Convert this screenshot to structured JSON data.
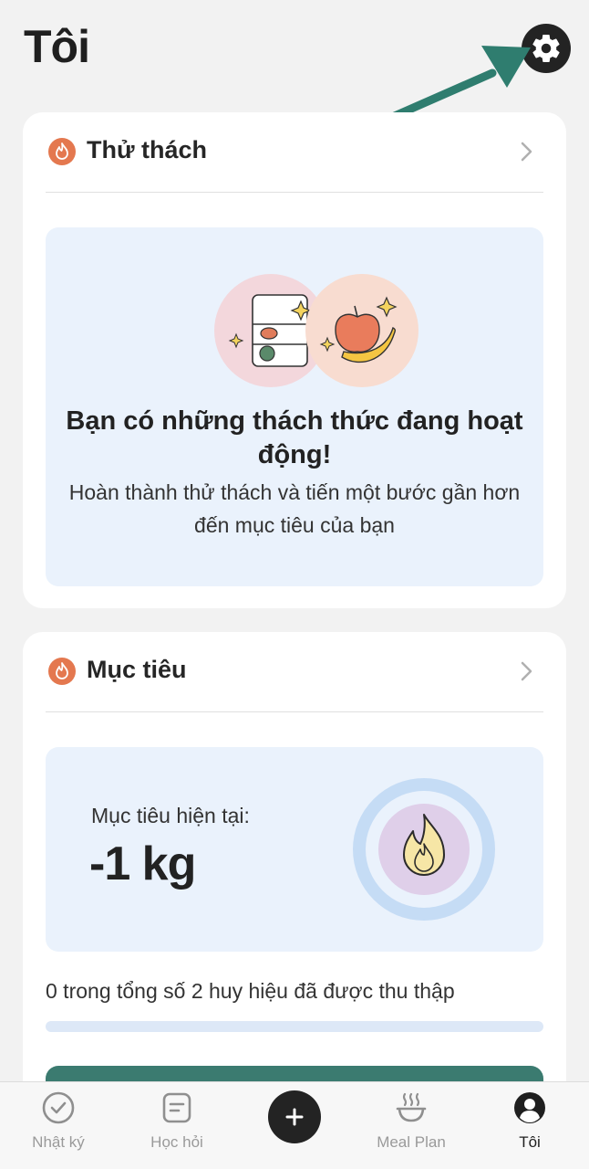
{
  "header": {
    "title": "Tôi",
    "settings_icon": "gear-icon"
  },
  "challenges": {
    "title": "Thử thách",
    "heading": "Bạn có những thách thức đang hoạt động!",
    "subtitle": "Hoàn thành thử thách và tiến một bước gần hơn đến mục tiêu của bạn"
  },
  "goals": {
    "title": "Mục tiêu",
    "current_label": "Mục tiêu hiện tại:",
    "current_value": "-1 kg",
    "badges_text": "0 trong tổng số 2 huy hiệu đã được thu thập",
    "badges_collected": 0,
    "badges_total": 2
  },
  "tabbar": {
    "items": [
      {
        "label": "Nhật ký",
        "icon": "check-circle-icon",
        "active": false
      },
      {
        "label": "Học hỏi",
        "icon": "notepad-icon",
        "active": false
      },
      {
        "label": "",
        "icon": "plus-icon",
        "active": false
      },
      {
        "label": "Meal Plan",
        "icon": "steaming-bowl-icon",
        "active": false
      },
      {
        "label": "Tôi",
        "icon": "profile-icon",
        "active": true
      }
    ]
  },
  "colors": {
    "accent_green": "#3b7b70",
    "flame_orange": "#e4784f",
    "panel_blue": "#eaf2fc",
    "dark": "#232323"
  }
}
